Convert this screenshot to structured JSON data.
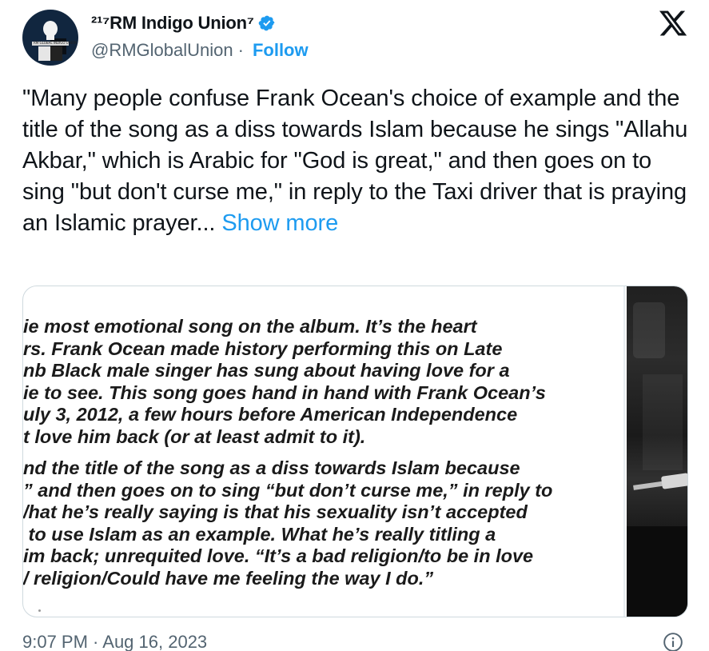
{
  "author": {
    "display_name": "²¹⁷RM Indigo Union⁷",
    "handle": "@RMGlobalUnion",
    "separator": "·",
    "follow_label": "Follow",
    "avatar_text": "RM GLOBAL INDIGO UNION"
  },
  "tweet": {
    "text": "\"Many people confuse Frank Ocean's choice of example and the title of the song as a diss towards Islam because he sings \"Allahu Akbar,\" which is Arabic for \"God is great,\" and then goes on to sing \"but don't curse me,\" in reply to the Taxi driver that is praying an Islamic prayer... ",
    "show_more": "Show more",
    "timestamp": "9:07 PM · Aug 16, 2023"
  },
  "card": {
    "paragraph1": [
      "ie most emotional song on the album. It’s the heart",
      "rs. Frank Ocean made history performing this on Late",
      "nb Black male singer has sung about having love for a",
      "ie to see. This song goes hand in hand with Frank Ocean’s",
      "uly 3, 2012, a few hours before American Independence",
      "t love him back (or at least admit to it)."
    ],
    "paragraph2": [
      "nd the title of the song as a diss towards Islam because",
      "” and then goes on to sing “but don’t curse me,” in reply to",
      "/hat he’s really saying is that his sexuality isn’t accepted",
      " to use Islam as an example. What he’s really titling a",
      "im back; unrequited love. “It’s a bad religion/to be in love",
      "/ religion/Could have me feeling the way I do.”"
    ]
  },
  "icons": {
    "verified": "verified-badge-icon",
    "brand": "x-logo-icon",
    "info": "info-icon"
  },
  "colors": {
    "accent": "#1d9bf0",
    "text": "#0f1419",
    "muted": "#536471",
    "border": "#cfd9de"
  }
}
